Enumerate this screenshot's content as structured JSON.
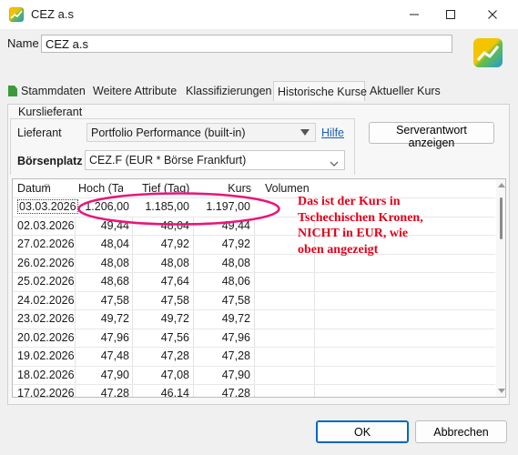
{
  "window": {
    "title": "CEZ a.s"
  },
  "name_field": {
    "label": "Name",
    "value": "CEZ a.s"
  },
  "tabs": [
    {
      "label": "Stammdaten"
    },
    {
      "label": "Weitere Attribute"
    },
    {
      "label": "Klassifizierungen"
    },
    {
      "label": "Historische Kurse",
      "active": true
    },
    {
      "label": "Aktueller Kurs"
    }
  ],
  "kurslieferant": {
    "group_title": "Kurslieferant",
    "lieferant_label": "Lieferant",
    "lieferant_value": "Portfolio Performance (built-in)",
    "hilfe_link": "Hilfe",
    "server_button": "Serverantwort anzeigen",
    "boerse_label": "Börsenplatz",
    "boerse_value": "CEZ.F (EUR * Börse Frankfurt)"
  },
  "table": {
    "headers": {
      "datum": "Datum",
      "hoch": "Hoch (Ta",
      "tief": "Tief (Tag)",
      "kurs": "Kurs",
      "volumen": "Volumen"
    },
    "rows": [
      {
        "datum": "03.03.2026",
        "hoch": "1.206,00",
        "tief": "1.185,00",
        "kurs": "1.197,00"
      },
      {
        "datum": "02.03.2026",
        "hoch": "49,44",
        "tief": "48,04",
        "kurs": "49,44"
      },
      {
        "datum": "27.02.2026",
        "hoch": "48,04",
        "tief": "47,92",
        "kurs": "47,92"
      },
      {
        "datum": "26.02.2026",
        "hoch": "48,08",
        "tief": "48,08",
        "kurs": "48,08"
      },
      {
        "datum": "25.02.2026",
        "hoch": "48,68",
        "tief": "47,64",
        "kurs": "48,06"
      },
      {
        "datum": "24.02.2026",
        "hoch": "47,58",
        "tief": "47,58",
        "kurs": "47,58"
      },
      {
        "datum": "23.02.2026",
        "hoch": "49,72",
        "tief": "49,72",
        "kurs": "49,72"
      },
      {
        "datum": "20.02.2026",
        "hoch": "47,96",
        "tief": "47,56",
        "kurs": "47,96"
      },
      {
        "datum": "19.02.2026",
        "hoch": "47,48",
        "tief": "47,28",
        "kurs": "47,28"
      },
      {
        "datum": "18.02.2026",
        "hoch": "47,90",
        "tief": "47,08",
        "kurs": "47,90"
      },
      {
        "datum": "17.02.2026",
        "hoch": "47,28",
        "tief": "46,14",
        "kurs": "47,28"
      }
    ]
  },
  "annotation": {
    "text": "Das ist der Kurs in Tschechischen Kronen, NICHT in EUR, wie oben angezeigt",
    "color": "#e0001b",
    "ellipse_color": "#e8157a"
  },
  "buttons": {
    "ok": "OK",
    "cancel": "Abbrechen"
  },
  "icons": {
    "app": "portfolio-performance-logo-icon",
    "minimize": "minimize-icon",
    "maximize": "maximize-icon",
    "close": "close-icon"
  }
}
